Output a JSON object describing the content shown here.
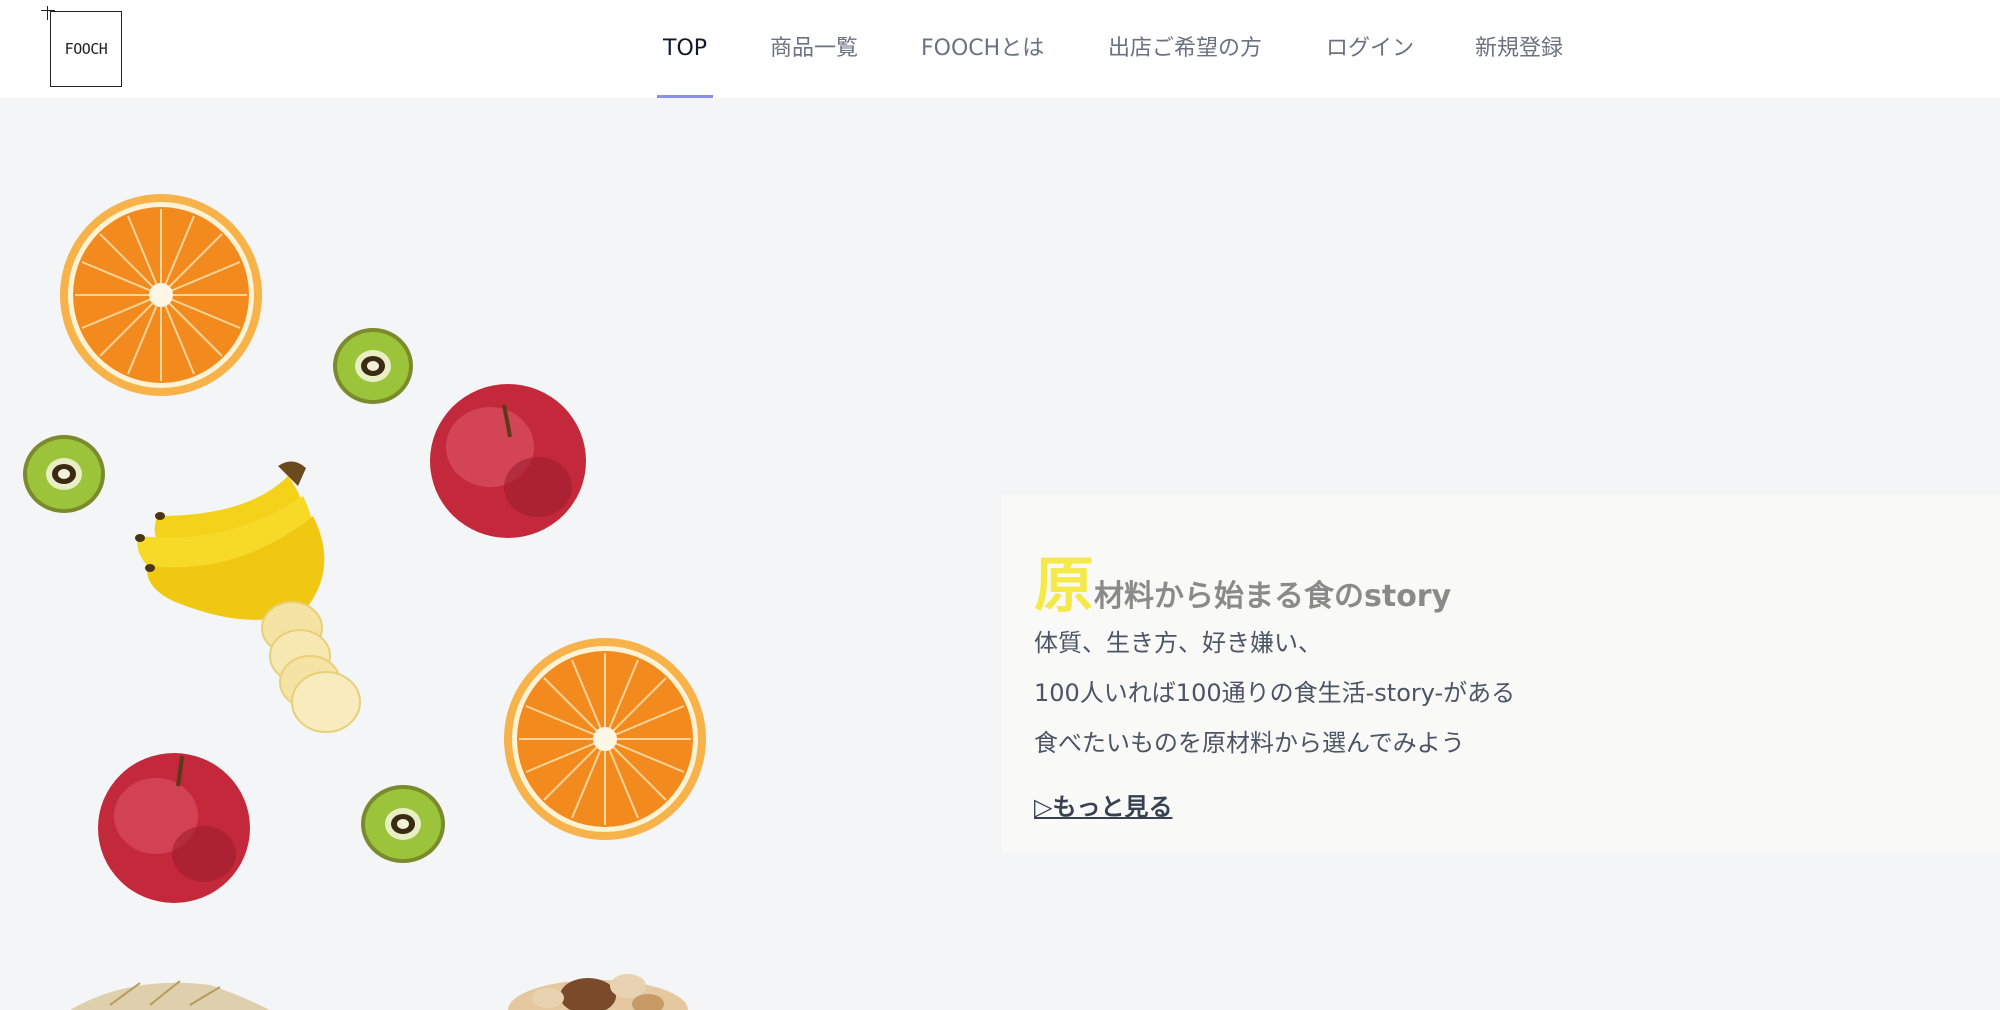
{
  "header": {
    "logo_text": "FOOCH",
    "nav": [
      {
        "label": "TOP",
        "active": true
      },
      {
        "label": "商品一覧",
        "active": false
      },
      {
        "label": "FOOCHとは",
        "active": false
      },
      {
        "label": "出店ご希望の方",
        "active": false
      },
      {
        "label": "ログイン",
        "active": false
      },
      {
        "label": "新規登録",
        "active": false
      }
    ],
    "accent_color": "#8b8fe8"
  },
  "hero": {
    "images": [
      "orange-image",
      "kiwi-image",
      "apple-image",
      "banana-image",
      "wheat-image",
      "nuts-image"
    ]
  },
  "story": {
    "title_first_char": "原",
    "title_rest": "材料から始まる食のstory",
    "lines": [
      "体質、生き方、好き嫌い、",
      "100人いれば100通りの食生活-story-がある",
      "食べたいものを原材料から選んでみよう"
    ],
    "more_link": "▷もっと見る",
    "highlight_color": "#f5e94a"
  }
}
